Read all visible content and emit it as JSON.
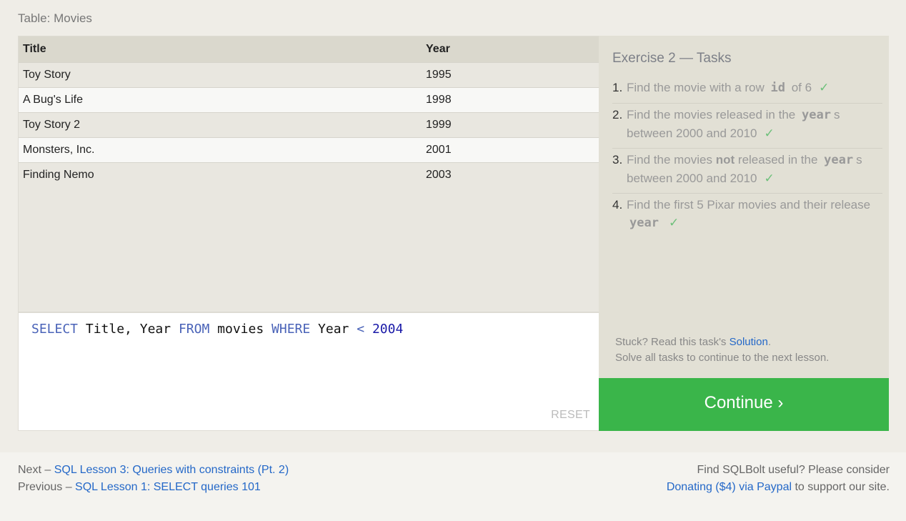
{
  "table_label": "Table: Movies",
  "table": {
    "headers": [
      "Title",
      "Year"
    ],
    "rows": [
      [
        "Toy Story",
        "1995"
      ],
      [
        "A Bug's Life",
        "1998"
      ],
      [
        "Toy Story 2",
        "1999"
      ],
      [
        "Monsters, Inc.",
        "2001"
      ],
      [
        "Finding Nemo",
        "2003"
      ]
    ]
  },
  "editor": {
    "tokens": {
      "select": "SELECT",
      "cols": "Title, Year",
      "from": "FROM",
      "table": "movies",
      "where": "WHERE",
      "col": "Year",
      "op": "<",
      "num": "2004"
    },
    "reset_label": "RESET"
  },
  "exercise": {
    "title": "Exercise 2 — Tasks",
    "tasks": [
      {
        "n": "1.",
        "pre": "Find the movie with a row",
        "code": "id",
        "post": "of 6"
      },
      {
        "n": "2.",
        "pre": "Find the movies released in the",
        "code": "year",
        "post": "s between 2000 and 2010"
      },
      {
        "n": "3.",
        "pre1": "Find the movies",
        "bold": "not",
        "pre2": "released in the",
        "code": "year",
        "post": "s between 2000 and 2010"
      },
      {
        "n": "4.",
        "pre": "Find the first 5 Pixar movies and their release",
        "code": "year",
        "post": ""
      }
    ],
    "check_glyph": "✓",
    "stuck_pre": "Stuck? Read this task's",
    "solution_link": "Solution",
    "stuck_post": ".",
    "solve_all": "Solve all tasks to continue to the next lesson."
  },
  "continue_label": "Continue ›",
  "footer": {
    "next_prefix": "Next –",
    "next_link": "SQL Lesson 3: Queries with constraints (Pt. 2)",
    "prev_prefix": "Previous –",
    "prev_link": "SQL Lesson 1: SELECT queries 101",
    "donate_line1": "Find SQLBolt useful? Please consider",
    "donate_link": "Donating ($4) via Paypal",
    "donate_suffix": "to support our site."
  },
  "colors": {
    "accent_green": "#3ab54a",
    "link_blue": "#2468c8",
    "check_green": "#6dc07a"
  }
}
